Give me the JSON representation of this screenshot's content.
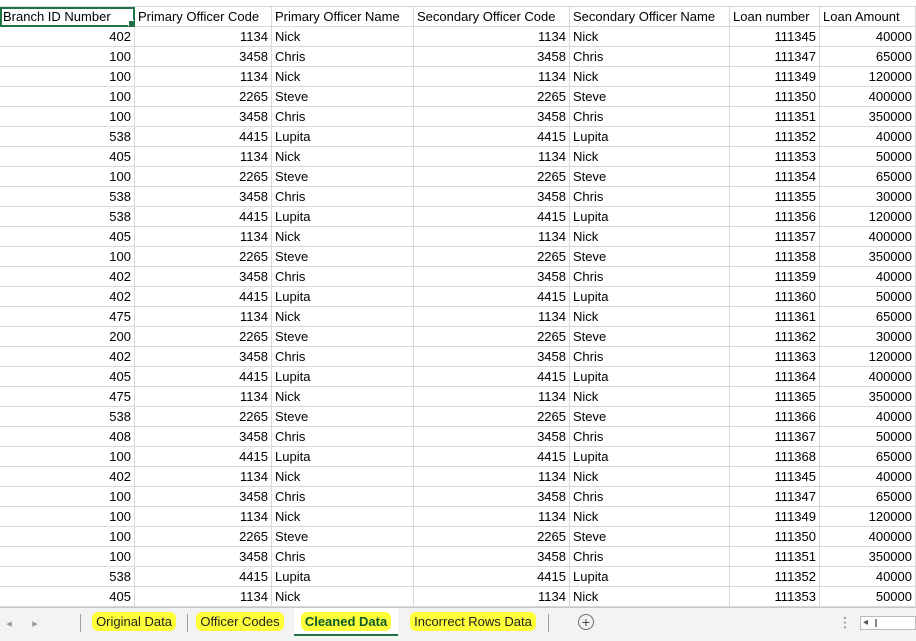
{
  "columns": [
    "Branch ID Number",
    "Primary Officer Code",
    "Primary Officer Name",
    "Secondary Officer Code",
    "Secondary Officer Name",
    "Loan number",
    "Loan Amount"
  ],
  "rows": [
    [
      "402",
      "1134",
      "Nick",
      "1134",
      "Nick",
      "111345",
      "40000"
    ],
    [
      "100",
      "3458",
      "Chris",
      "3458",
      "Chris",
      "111347",
      "65000"
    ],
    [
      "100",
      "1134",
      "Nick",
      "1134",
      "Nick",
      "111349",
      "120000"
    ],
    [
      "100",
      "2265",
      "Steve",
      "2265",
      "Steve",
      "111350",
      "400000"
    ],
    [
      "100",
      "3458",
      "Chris",
      "3458",
      "Chris",
      "111351",
      "350000"
    ],
    [
      "538",
      "4415",
      "Lupita",
      "4415",
      "Lupita",
      "111352",
      "40000"
    ],
    [
      "405",
      "1134",
      "Nick",
      "1134",
      "Nick",
      "111353",
      "50000"
    ],
    [
      "100",
      "2265",
      "Steve",
      "2265",
      "Steve",
      "111354",
      "65000"
    ],
    [
      "538",
      "3458",
      "Chris",
      "3458",
      "Chris",
      "111355",
      "30000"
    ],
    [
      "538",
      "4415",
      "Lupita",
      "4415",
      "Lupita",
      "111356",
      "120000"
    ],
    [
      "405",
      "1134",
      "Nick",
      "1134",
      "Nick",
      "111357",
      "400000"
    ],
    [
      "100",
      "2265",
      "Steve",
      "2265",
      "Steve",
      "111358",
      "350000"
    ],
    [
      "402",
      "3458",
      "Chris",
      "3458",
      "Chris",
      "111359",
      "40000"
    ],
    [
      "402",
      "4415",
      "Lupita",
      "4415",
      "Lupita",
      "111360",
      "50000"
    ],
    [
      "475",
      "1134",
      "Nick",
      "1134",
      "Nick",
      "111361",
      "65000"
    ],
    [
      "200",
      "2265",
      "Steve",
      "2265",
      "Steve",
      "111362",
      "30000"
    ],
    [
      "402",
      "3458",
      "Chris",
      "3458",
      "Chris",
      "111363",
      "120000"
    ],
    [
      "405",
      "4415",
      "Lupita",
      "4415",
      "Lupita",
      "111364",
      "400000"
    ],
    [
      "475",
      "1134",
      "Nick",
      "1134",
      "Nick",
      "111365",
      "350000"
    ],
    [
      "538",
      "2265",
      "Steve",
      "2265",
      "Steve",
      "111366",
      "40000"
    ],
    [
      "408",
      "3458",
      "Chris",
      "3458",
      "Chris",
      "111367",
      "50000"
    ],
    [
      "100",
      "4415",
      "Lupita",
      "4415",
      "Lupita",
      "111368",
      "65000"
    ],
    [
      "402",
      "1134",
      "Nick",
      "1134",
      "Nick",
      "111345",
      "40000"
    ],
    [
      "100",
      "3458",
      "Chris",
      "3458",
      "Chris",
      "111347",
      "65000"
    ],
    [
      "100",
      "1134",
      "Nick",
      "1134",
      "Nick",
      "111349",
      "120000"
    ],
    [
      "100",
      "2265",
      "Steve",
      "2265",
      "Steve",
      "111350",
      "400000"
    ],
    [
      "100",
      "3458",
      "Chris",
      "3458",
      "Chris",
      "111351",
      "350000"
    ],
    [
      "538",
      "4415",
      "Lupita",
      "4415",
      "Lupita",
      "111352",
      "40000"
    ],
    [
      "405",
      "1134",
      "Nick",
      "1134",
      "Nick",
      "111353",
      "50000"
    ]
  ],
  "tabs": [
    {
      "label": "Original Data",
      "active": false
    },
    {
      "label": "Officer Codes",
      "active": false
    },
    {
      "label": "Cleaned Data",
      "active": true
    },
    {
      "label": "Incorrect Rows Data",
      "active": false
    }
  ],
  "tabbar": {
    "prev_icon": "◂",
    "next_icon": "▸",
    "add_icon": "+",
    "more_icon": "⋮",
    "scroll_left_icon": "◂"
  },
  "colors": {
    "accent": "#217346",
    "highlight": "#ffff3a",
    "gridline": "#d8d8d8"
  }
}
